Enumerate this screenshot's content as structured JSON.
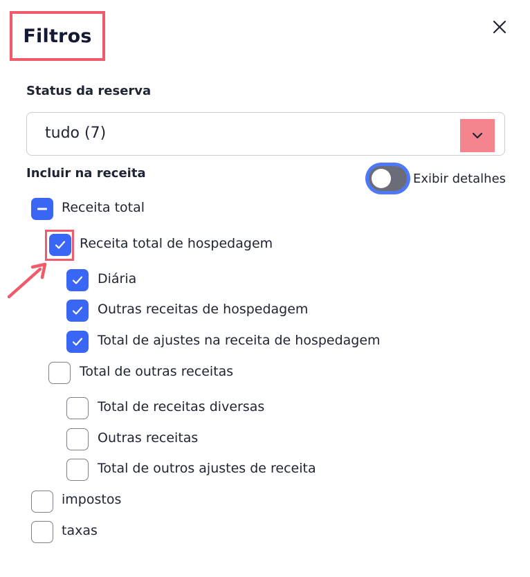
{
  "dialog": {
    "title": "Filtros",
    "close_icon": "close-icon"
  },
  "status": {
    "label": "Status da reserva",
    "selected": "tudo (7)",
    "arrow_icon": "chevron-down-icon"
  },
  "include": {
    "label": "Incluir na receita"
  },
  "details_toggle": {
    "label": "Exibir detalhes",
    "on": false
  },
  "tree": {
    "receita_total": {
      "label": "Receita total",
      "state": "indeterminate"
    },
    "hospedagem": {
      "label": "Receita total de hospedagem",
      "state": "checked"
    },
    "diaria": {
      "label": "Diária",
      "state": "checked"
    },
    "outras_hosp": {
      "label": "Outras receitas de hospedagem",
      "state": "checked"
    },
    "ajustes_hosp": {
      "label": "Total de ajustes na receita de hospedagem",
      "state": "checked"
    },
    "outras_receitas_total": {
      "label": "Total de outras receitas",
      "state": "unchecked"
    },
    "diversas": {
      "label": "Total de receitas diversas",
      "state": "unchecked"
    },
    "outras_receitas": {
      "label": "Outras receitas",
      "state": "unchecked"
    },
    "outros_ajustes": {
      "label": "Total de outros ajustes de receita",
      "state": "unchecked"
    },
    "impostos": {
      "label": "impostos",
      "state": "unchecked"
    },
    "taxas": {
      "label": "taxas",
      "state": "unchecked"
    }
  },
  "colors": {
    "accent": "#3a66f6",
    "highlight": "#ef5b6b",
    "select_arrow_bg": "#f4848d"
  }
}
